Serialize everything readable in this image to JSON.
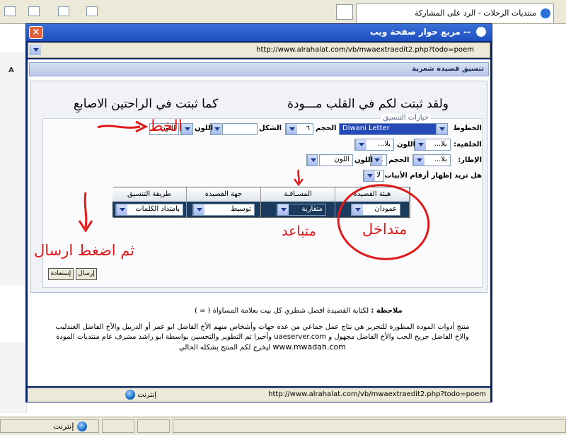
{
  "browser": {
    "tab_title": "منتديات الرحلات - الرد على المشاركة",
    "status_zone": "إنترنت"
  },
  "popup": {
    "title": "-- مربع حوار صفحة ويب",
    "url": "http://www.alrahalat.com/vb/mwaextraedit2.php?todo=poem",
    "section_header": "تنسيق قصيدة شعرية",
    "poem_hemistich_1": "ولقد ثبتت لكم في القلب مـــودة",
    "poem_hemistich_2": "كما ثبتت في الراحتين الاصابعِ",
    "legend": "خيارات التنسيق",
    "font_label": "الخطوط",
    "font_value": "Diwani Letter",
    "size_label": "الحجم",
    "size_value": "٦",
    "shape_label": "الشكل",
    "color_label": "اللون",
    "color_value": "اللون",
    "background_label": "الخلفية:",
    "bg_value": "بلا...",
    "bg_color_label": "اللون",
    "bg_color_value": "بلا...",
    "border_label": "الإطار:",
    "border_value": "بلا...",
    "border_size_label": "الحجم",
    "border_size_value": "٤",
    "border_color_label": "اللون",
    "border_color_value": "اللون",
    "numbers_label": "هل تريد إظهار أرقام الأبيات ؟",
    "numbers_value": "لا",
    "table_headers": [
      "هيئة القصيدة",
      "المسـافـة",
      "جهة القصيدة",
      "طريقة التنسيق"
    ],
    "table_values": [
      "عمودان",
      "متقاربة",
      "توسيط",
      "بامتداد الكلمات"
    ],
    "send_button": "إرسال",
    "reset_button": "إستعادة",
    "note_bold": "ملاحظة :",
    "note_text": "لكتابة القصيدة افصل شطري كل بيت بعلامة المساواة ( = )",
    "footer_line1": "منتج أدوات المودة المطورة للتحرير هي نتاج عمل جماعي من عدة جهات وأشخاص منهم الأخ الفاضل ابو عمر أو الدريبل والأخ الفاضل العندليب",
    "footer_line2": "والاخ الفاضل جريح الحب والأخ الفاضل مجهول و uaeserver.com وأخيرا تم التطوير والتحسين بواسطة ابو راشد مشرف عام منتديات المودة",
    "footer_line3_url": "www.mwadah.com",
    "footer_line3_text": "ليخرج لكم المنتج بشكله الحالي",
    "status_url": "http://www.alrahalat.com/vb/mwaextraedit2.php?todo=poem",
    "status_zone": "إنترنت"
  },
  "annotations": {
    "font_hint": "الخط",
    "press_send": "ثم اضغط ارسال",
    "spacing_hint": "متباعد",
    "layout_hint": "متداخل"
  }
}
